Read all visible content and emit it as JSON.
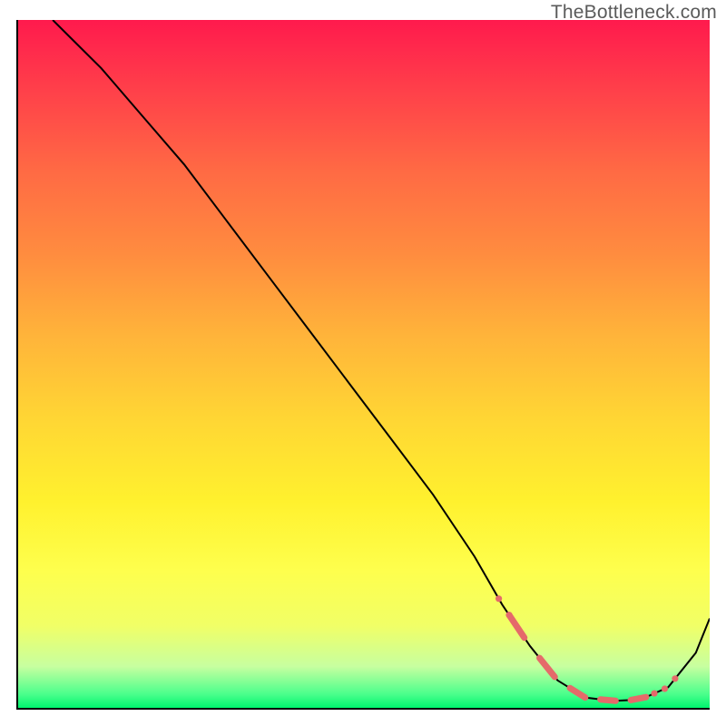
{
  "watermark": "TheBottleneck.com",
  "chart_data": {
    "type": "line",
    "title": "",
    "xlabel": "",
    "ylabel": "",
    "xlim": [
      0,
      100
    ],
    "ylim": [
      0,
      100
    ],
    "series": [
      {
        "name": "curve",
        "x": [
          5,
          8,
          12,
          18,
          24,
          30,
          36,
          42,
          48,
          54,
          60,
          66,
          70,
          74,
          78,
          82,
          86,
          90,
          94,
          98,
          100
        ],
        "y": [
          100,
          97,
          93,
          86,
          79,
          71,
          63,
          55,
          47,
          39,
          31,
          22,
          15,
          9,
          4,
          1.5,
          1,
          1.2,
          3,
          8,
          13
        ]
      }
    ],
    "highlighted_range_x": [
      71,
      92
    ],
    "colors": {
      "gradient_top": "#ff1a4d",
      "gradient_bottom": "#00f56e",
      "curve": "#000000",
      "highlight": "#e56a6a"
    }
  }
}
